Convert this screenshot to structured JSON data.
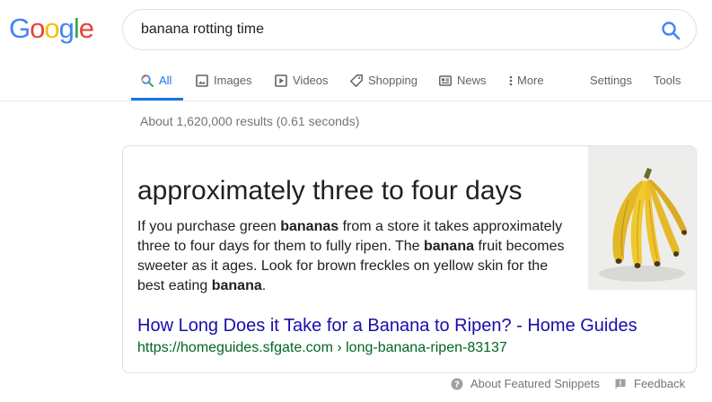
{
  "logo": {
    "letters": [
      "G",
      "o",
      "o",
      "g",
      "l",
      "e"
    ],
    "colors": [
      "#4285F4",
      "#EA4335",
      "#FBBC05",
      "#4285F4",
      "#34A853",
      "#EA4335"
    ]
  },
  "search": {
    "query": "banana rotting time",
    "icon": "search-icon"
  },
  "tabs": [
    {
      "label": "All",
      "icon": "search-icon",
      "active": true
    },
    {
      "label": "Images",
      "icon": "image-icon"
    },
    {
      "label": "Videos",
      "icon": "play-icon"
    },
    {
      "label": "Shopping",
      "icon": "tag-icon"
    },
    {
      "label": "News",
      "icon": "news-icon"
    },
    {
      "label": "More",
      "icon": "more-vert-icon"
    },
    {
      "label": "Settings"
    },
    {
      "label": "Tools"
    }
  ],
  "stats": "About 1,620,000 results (0.61 seconds)",
  "snippet": {
    "answer": "approximately three to four days",
    "text_parts": [
      {
        "t": "If you purchase green ",
        "b": false
      },
      {
        "t": "bananas",
        "b": true
      },
      {
        "t": " from a store it takes approximately three to four days for them to fully ripen. The ",
        "b": false
      },
      {
        "t": "banana",
        "b": true
      },
      {
        "t": " fruit becomes sweeter as it ages. Look for brown freckles on yellow skin for the best eating ",
        "b": false
      },
      {
        "t": "banana",
        "b": true
      },
      {
        "t": ".",
        "b": false
      }
    ],
    "title": "How Long Does it Take for a Banana to Ripen? - Home Guides",
    "url": "https://homeguides.sfgate.com › long-banana-ripen-83137",
    "image": "banana-bunch-image"
  },
  "footer": {
    "about": "About Featured Snippets",
    "feedback": "Feedback"
  },
  "colors": {
    "link": "#1a0dab",
    "url": "#006621",
    "accent": "#1a73e8",
    "muted": "#70757a"
  }
}
